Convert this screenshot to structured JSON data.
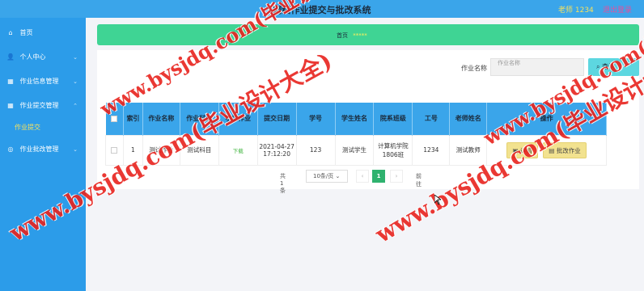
{
  "header": {
    "title": "网络作业提交与批改系统",
    "user": "老师 1234",
    "logout": "退出登录"
  },
  "sidebar": {
    "items": [
      {
        "label": "首页",
        "icon": "home-icon"
      },
      {
        "label": "个人中心",
        "icon": "user-icon"
      },
      {
        "label": "作业信息管理",
        "icon": "grid-icon"
      },
      {
        "label": "作业提交管理",
        "icon": "grid-icon"
      },
      {
        "label": "作业批改管理",
        "icon": "circle-icon"
      }
    ],
    "sub_item": "作业提交"
  },
  "breadcrumb": {
    "home": "首页",
    "stars": "*****"
  },
  "search": {
    "label": "作业名称",
    "placeholder": "作业名称",
    "button": "查询"
  },
  "table": {
    "headers": [
      "索引",
      "作业名称",
      "作业科目",
      "学生作业",
      "提交日期",
      "学号",
      "学生姓名",
      "院系班级",
      "工号",
      "老师姓名",
      "操作"
    ],
    "rows": [
      {
        "index": "1",
        "name": "测试作业",
        "subject": "测试科目",
        "homework": "下载",
        "date": "2021-04-27 17:12:20",
        "student_id": "123",
        "student_name": "测试学生",
        "class": "计算机学院1806班",
        "teacher_id": "1234",
        "teacher_name": "测试教师",
        "detail_btn": "详情",
        "grade_btn": "批改作业"
      }
    ]
  },
  "pager": {
    "total": "共 1 条",
    "size": "10条/页",
    "page": "1",
    "goto": "前往"
  },
  "watermarks": [
    "www.bysjdq.com(毕业设计大全)",
    "www.bysjdq.com(毕业设计大全)",
    "www.bysjdq.com(毕业设计大全)",
    "www.bysjdq.com(毕业设计大全)"
  ],
  "colors": {
    "topbar": "#3aa5ea",
    "sidebar": "#2c9ce9",
    "breadcrumb": "#3fd494",
    "watermark": "#e8231e"
  }
}
